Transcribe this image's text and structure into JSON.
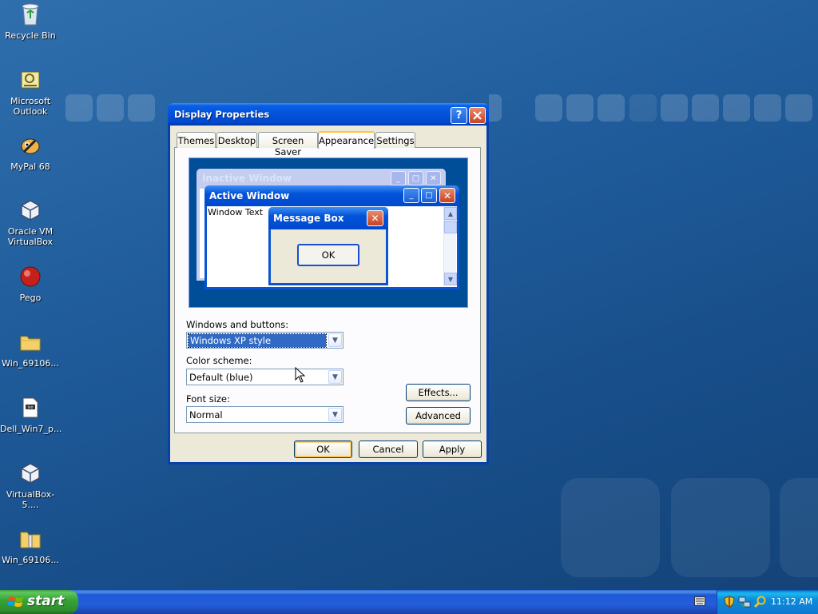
{
  "desktop": {
    "icons": [
      {
        "label": "Recycle Bin"
      },
      {
        "label": "Microsoft Outlook"
      },
      {
        "label": "MyPal 68"
      },
      {
        "label": "Oracle VM VirtualBox"
      },
      {
        "label": "Pego"
      },
      {
        "label": "Win_69106..."
      },
      {
        "label": "Dell_Win7_p..."
      },
      {
        "label": "VirtualBox-5...."
      },
      {
        "label": "Win_69106..."
      }
    ]
  },
  "dialog": {
    "title": "Display Properties",
    "help_icon": "?",
    "close_icon": "close-icon",
    "tabs": [
      {
        "label": "Themes",
        "active": false
      },
      {
        "label": "Desktop",
        "active": false
      },
      {
        "label": "Screen Saver",
        "active": false
      },
      {
        "label": "Appearance",
        "active": true
      },
      {
        "label": "Settings",
        "active": false
      }
    ],
    "preview": {
      "inactive_title": "Inactive Window",
      "active_title": "Active Window",
      "window_text": "Window Text",
      "message_box_title": "Message Box",
      "message_box_ok": "OK"
    },
    "windows_buttons_label": "Windows and buttons:",
    "windows_buttons_value": "Windows XP style",
    "color_scheme_label": "Color scheme:",
    "color_scheme_value": "Default (blue)",
    "font_size_label": "Font size:",
    "font_size_value": "Normal",
    "effects_button": "Effects...",
    "advanced_button": "Advanced",
    "ok_button": "OK",
    "cancel_button": "Cancel",
    "apply_button": "Apply"
  },
  "taskbar": {
    "start_label": "start",
    "clock": "11:12 AM"
  },
  "colors": {
    "accent": "#0048cf",
    "desktop": "#1f5b9a",
    "start_green": "#37a537",
    "selection": "#316ac5"
  }
}
